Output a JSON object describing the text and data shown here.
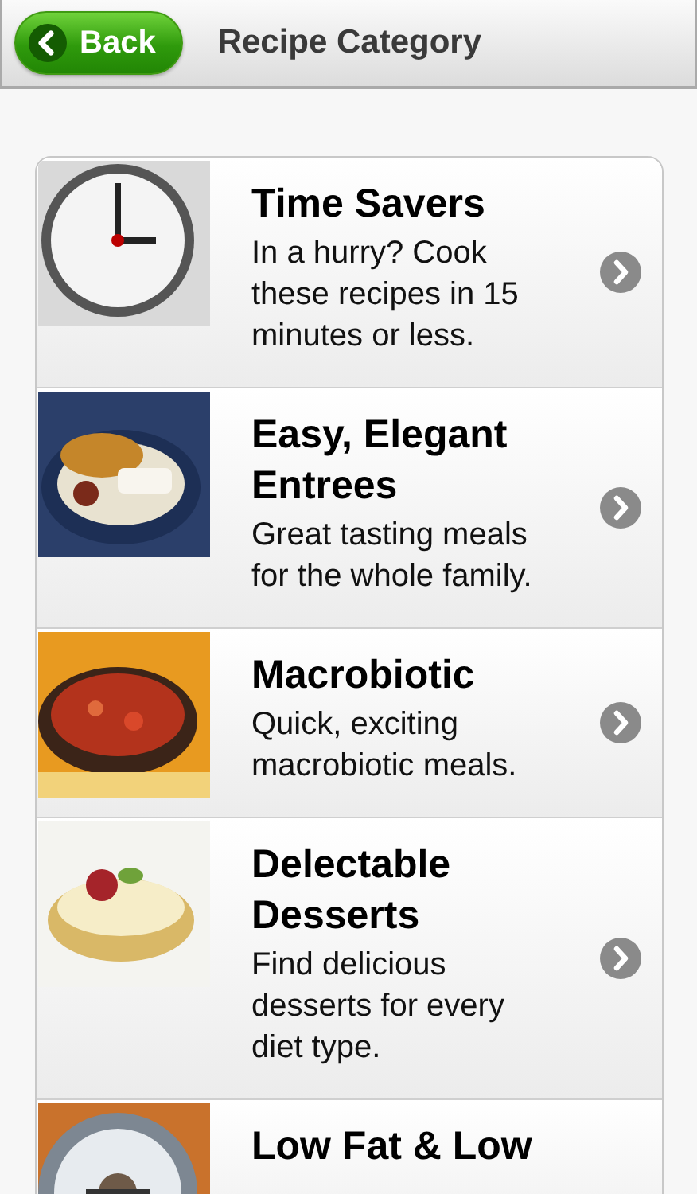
{
  "header": {
    "back_button": "Back",
    "title": "Recipe Category"
  },
  "categories": [
    {
      "title": "Time Savers",
      "description": "In a hurry? Cook these recipes in 15 minutes or less."
    },
    {
      "title": "Easy, Elegant Entrees",
      "description": "Great tasting meals for the whole family."
    },
    {
      "title": "Macrobiotic",
      "description": "Quick, exciting macrobiotic meals."
    },
    {
      "title": "Delectable Desserts",
      "description": "Find delicious desserts for every diet type."
    },
    {
      "title": "Low Fat & Low"
    }
  ]
}
